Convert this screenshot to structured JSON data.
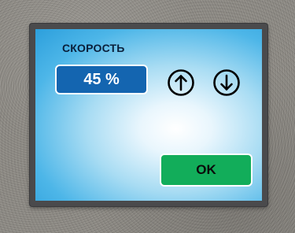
{
  "panel": {
    "label": "СКОРОСТЬ",
    "value": "45 %",
    "up_icon": "arrow-up-circle-icon",
    "down_icon": "arrow-down-circle-icon",
    "ok_label": "OK"
  },
  "colors": {
    "value_box": "#1465b0",
    "ok_button": "#12ad5a",
    "label_text": "#0a1f3a",
    "screen_edge": "#2c9fdc",
    "bezel": "#4a4a4c"
  }
}
